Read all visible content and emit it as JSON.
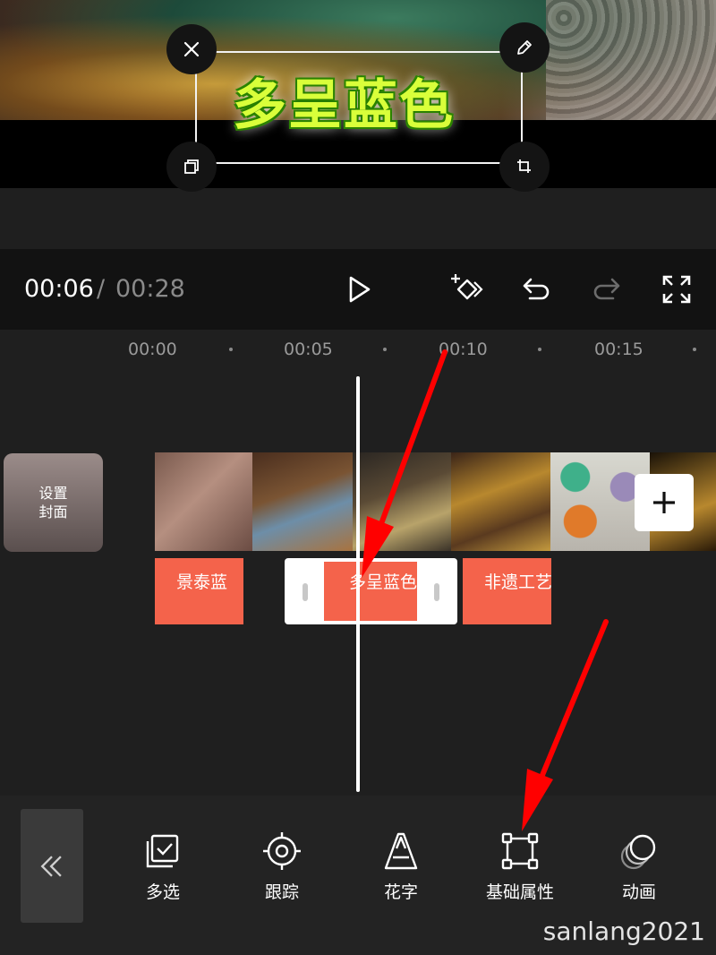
{
  "preview": {
    "overlay_text": "多呈蓝色",
    "handles": {
      "top_left": "close-icon",
      "top_right": "edit-pencil-icon",
      "bottom_left": "copy-icon",
      "bottom_right": "rotate-icon"
    }
  },
  "player": {
    "current_time": "00:06",
    "separator": "/",
    "total_time": "00:28",
    "controls": [
      "play-icon",
      "add-keyframe-icon",
      "undo-icon",
      "redo-icon",
      "fullscreen-icon"
    ]
  },
  "timeline": {
    "ruler": [
      "00:00",
      "00:05",
      "00:10",
      "00:15"
    ],
    "cover_button": {
      "line1": "设置",
      "line2": "封面"
    },
    "text_clips": [
      {
        "label": "景泰蓝",
        "selected": false
      },
      {
        "label": "多呈蓝色",
        "selected": true
      },
      {
        "label": "非遗工艺",
        "selected": false
      }
    ],
    "add_clip_icon": "plus-icon"
  },
  "toolbar": {
    "collapse_icon": "double-chevron-left-icon",
    "tools": [
      {
        "label": "多选",
        "icon": "multi-select-icon"
      },
      {
        "label": "跟踪",
        "icon": "tracking-target-icon"
      },
      {
        "label": "花字",
        "icon": "fancy-text-icon"
      },
      {
        "label": "基础属性",
        "icon": "basic-properties-icon"
      },
      {
        "label": "动画",
        "icon": "animation-icon"
      }
    ]
  },
  "watermark": "sanlang2021",
  "colors": {
    "background": "#1f1f1f",
    "text_clip": "#f4634b",
    "annotation_arrow": "#ff0000",
    "overlay_text_fill": "#d9ff3a",
    "overlay_text_outline": "#2f8a00"
  }
}
